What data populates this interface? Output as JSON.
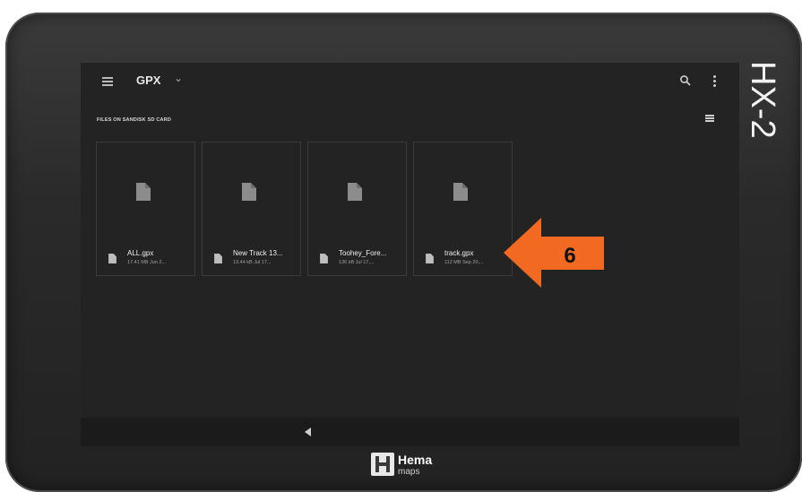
{
  "device": {
    "model_label": "HX-2",
    "logo_name": "Hema",
    "logo_sub": "maps"
  },
  "app": {
    "title": "GPX",
    "section_label": "FILES ON SANDISK SD CARD"
  },
  "files": [
    {
      "name": "ALL.gpx",
      "meta": "17.41 MB Jun 2..."
    },
    {
      "name": "New Track 13...",
      "meta": "13.44 kB Jul 17..."
    },
    {
      "name": "Toohey_Fore...",
      "meta": "136 kB Jul 17,..."
    },
    {
      "name": "track.gpx",
      "meta": "112 MB Sep 20,..."
    }
  ],
  "callout": {
    "step_number": "6",
    "color": "#f26a21"
  },
  "icons": {
    "menu": "hamburger-icon",
    "dropdown": "chevron-down-icon",
    "search": "search-icon",
    "more": "more-vert-icon",
    "view": "list-view-icon",
    "file": "file-icon",
    "back": "back-triangle-icon"
  }
}
